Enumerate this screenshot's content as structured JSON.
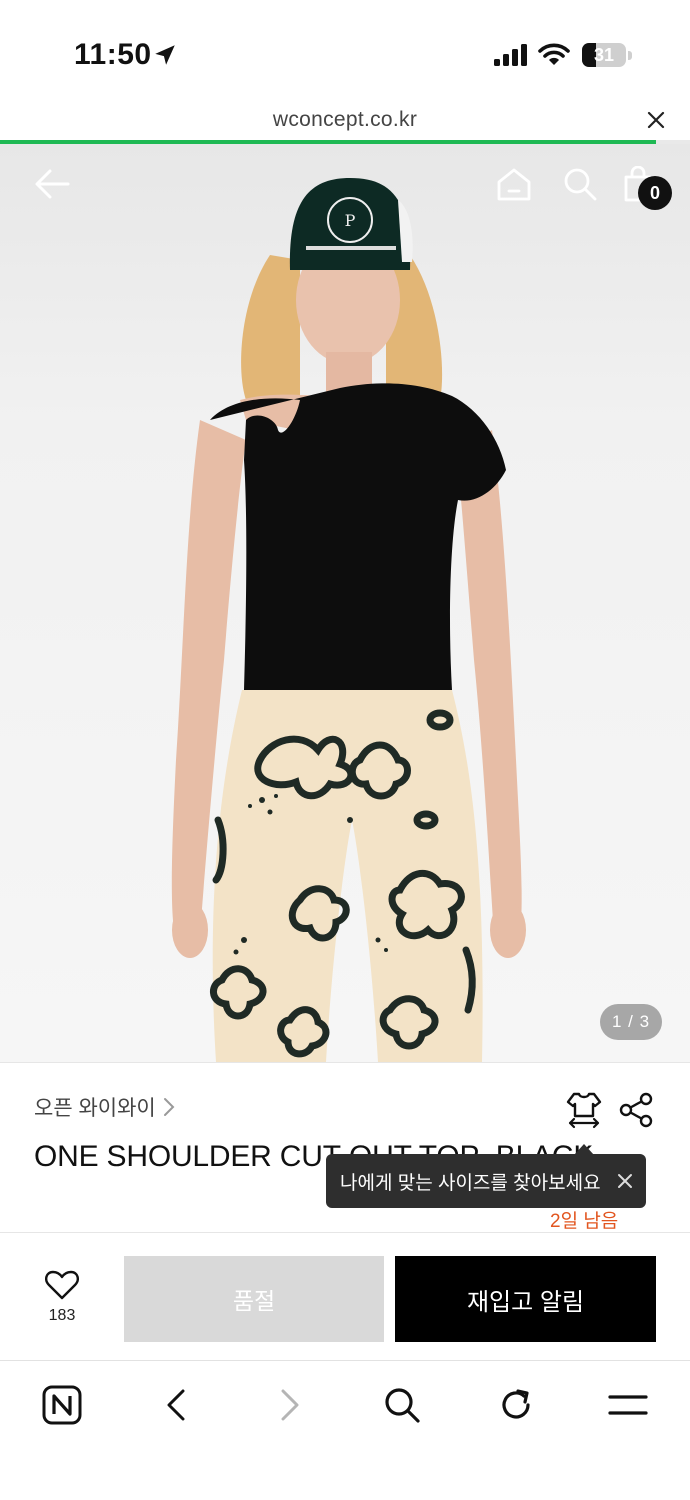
{
  "status_bar": {
    "time": "11:50",
    "battery": "31",
    "battery_fraction": 0.31
  },
  "browser": {
    "url": "wconcept.co.kr",
    "load_progress": 0.95
  },
  "product_image": {
    "cart_count": "0",
    "page_indicator": "1 / 3"
  },
  "product": {
    "brand": "오픈 와이와이",
    "title": "ONE SHOULDER CUT-OUT TOP_BLACK",
    "days_left": "2일 남음"
  },
  "tooltip": {
    "text": "나에게 맞는 사이즈를 찾아보세요"
  },
  "actions": {
    "like_count": "183",
    "soldout_label": "품절",
    "restock_label": "재입고 알림"
  },
  "colors": {
    "accent_green": "#1fb954",
    "days_left_orange": "#e2551f",
    "soldout_gray": "#d9d9d9",
    "primary_black": "#000000"
  },
  "icons": [
    "location-arrow-icon",
    "cellular-signal-icon",
    "wifi-icon",
    "close-icon",
    "back-arrow-icon",
    "home-icon",
    "search-icon",
    "shopping-bag-icon",
    "size-guide-icon",
    "share-icon",
    "heart-icon",
    "naver-logo-icon",
    "chevron-left-icon",
    "chevron-right-icon",
    "refresh-icon",
    "menu-icon"
  ]
}
